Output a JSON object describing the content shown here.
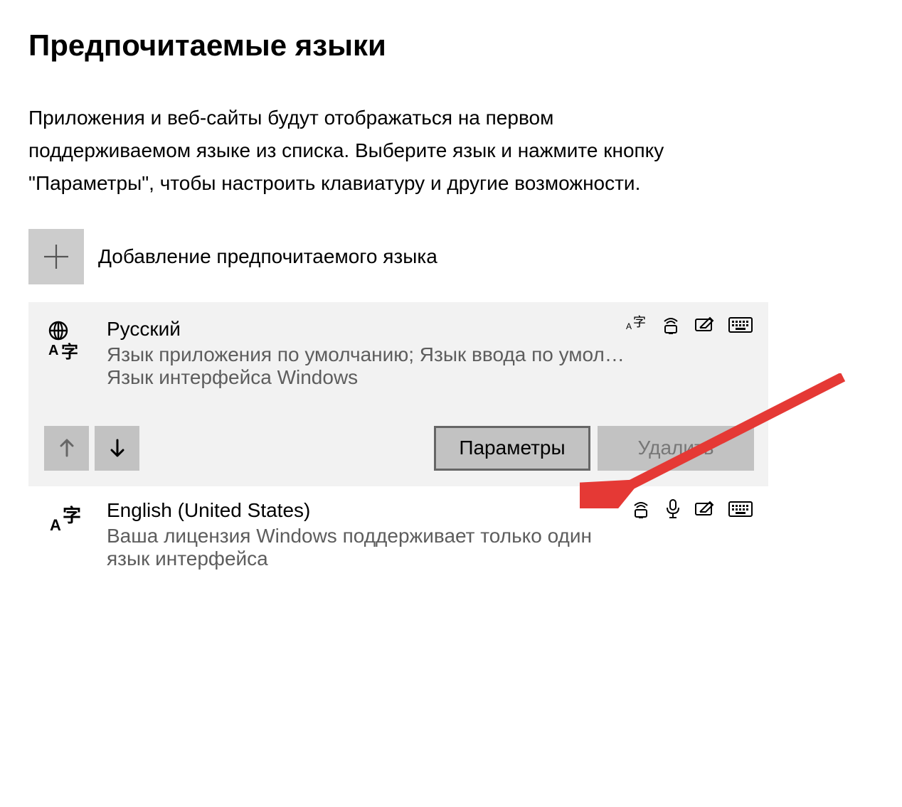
{
  "section": {
    "title": "Предпочитаемые языки",
    "description": "Приложения и веб-сайты будут отображаться на первом поддерживаемом языке из списка. Выберите язык и нажмите кнопку \"Параметры\", чтобы настроить клавиатуру и другие возможности.",
    "add_label": "Добавление предпочитаемого языка"
  },
  "languages": [
    {
      "name": "Русский",
      "subtitle1": "Язык приложения по умолчанию; Язык ввода по умол…",
      "subtitle2": "Язык интерфейса Windows",
      "buttons": {
        "options": "Параметры",
        "remove": "Удалить"
      }
    },
    {
      "name": "English (United States)",
      "subtitle1": "Ваша лицензия Windows поддерживает только один",
      "subtitle2": "язык интерфейса"
    }
  ]
}
